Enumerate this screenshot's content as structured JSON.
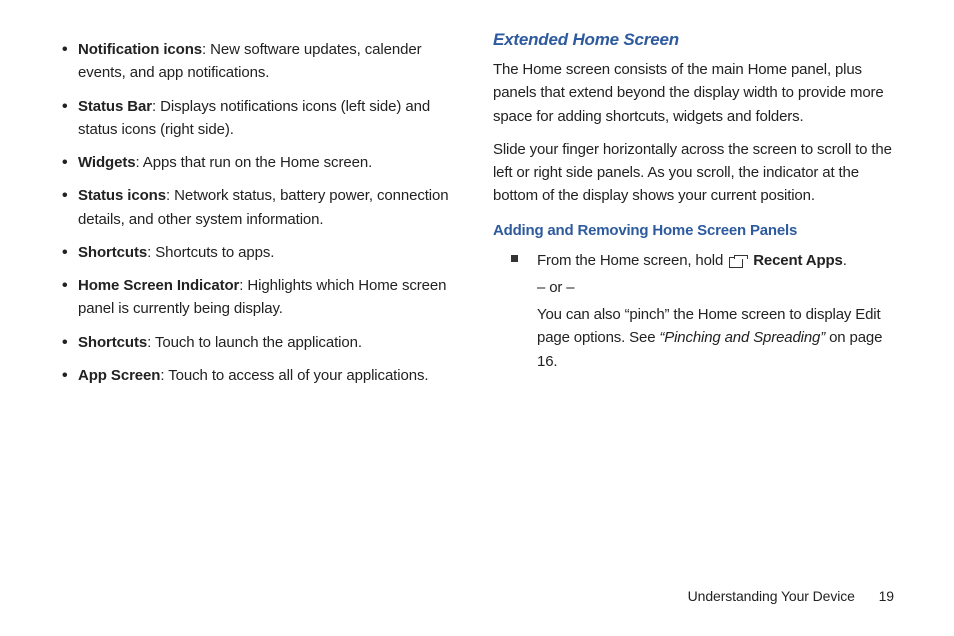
{
  "leftColumn": {
    "items": [
      {
        "term": "Notification icons",
        "desc": ": New software updates, calender events, and app notifications."
      },
      {
        "term": "Status Bar",
        "desc": ": Displays notifications icons (left side) and status icons (right side)."
      },
      {
        "term": "Widgets",
        "desc": ": Apps that run on the Home screen."
      },
      {
        "term": "Status icons",
        "desc": ": Network status, battery power, connection details, and other system information."
      },
      {
        "term": "Shortcuts",
        "desc": ": Shortcuts to apps."
      },
      {
        "term": "Home Screen Indicator",
        "desc": ": Highlights which Home screen panel is currently being display."
      },
      {
        "term": "Shortcuts",
        "desc": ": Touch to launch the application."
      },
      {
        "term": "App Screen",
        "desc": ": Touch to access all of your applications."
      }
    ]
  },
  "rightColumn": {
    "heading1": "Extended Home Screen",
    "para1": "The Home screen consists of the main Home panel, plus panels that extend beyond the display width to provide more space for adding shortcuts, widgets and folders.",
    "para2": "Slide your finger horizontally across the screen to scroll to the left or right side panels. As you scroll, the indicator at the bottom of the display shows your current position.",
    "heading2": "Adding and Removing Home Screen Panels",
    "step": {
      "lead": "From the Home screen, hold ",
      "iconLabel": "Recent Apps",
      "tail": ".",
      "or": "– or –",
      "altLine1": "You can also “pinch” the Home screen to display Edit page options. See ",
      "altRef": "“Pinching and Spreading”",
      "altLine2": " on page 16."
    }
  },
  "footer": {
    "section": "Understanding Your Device",
    "page": "19"
  }
}
